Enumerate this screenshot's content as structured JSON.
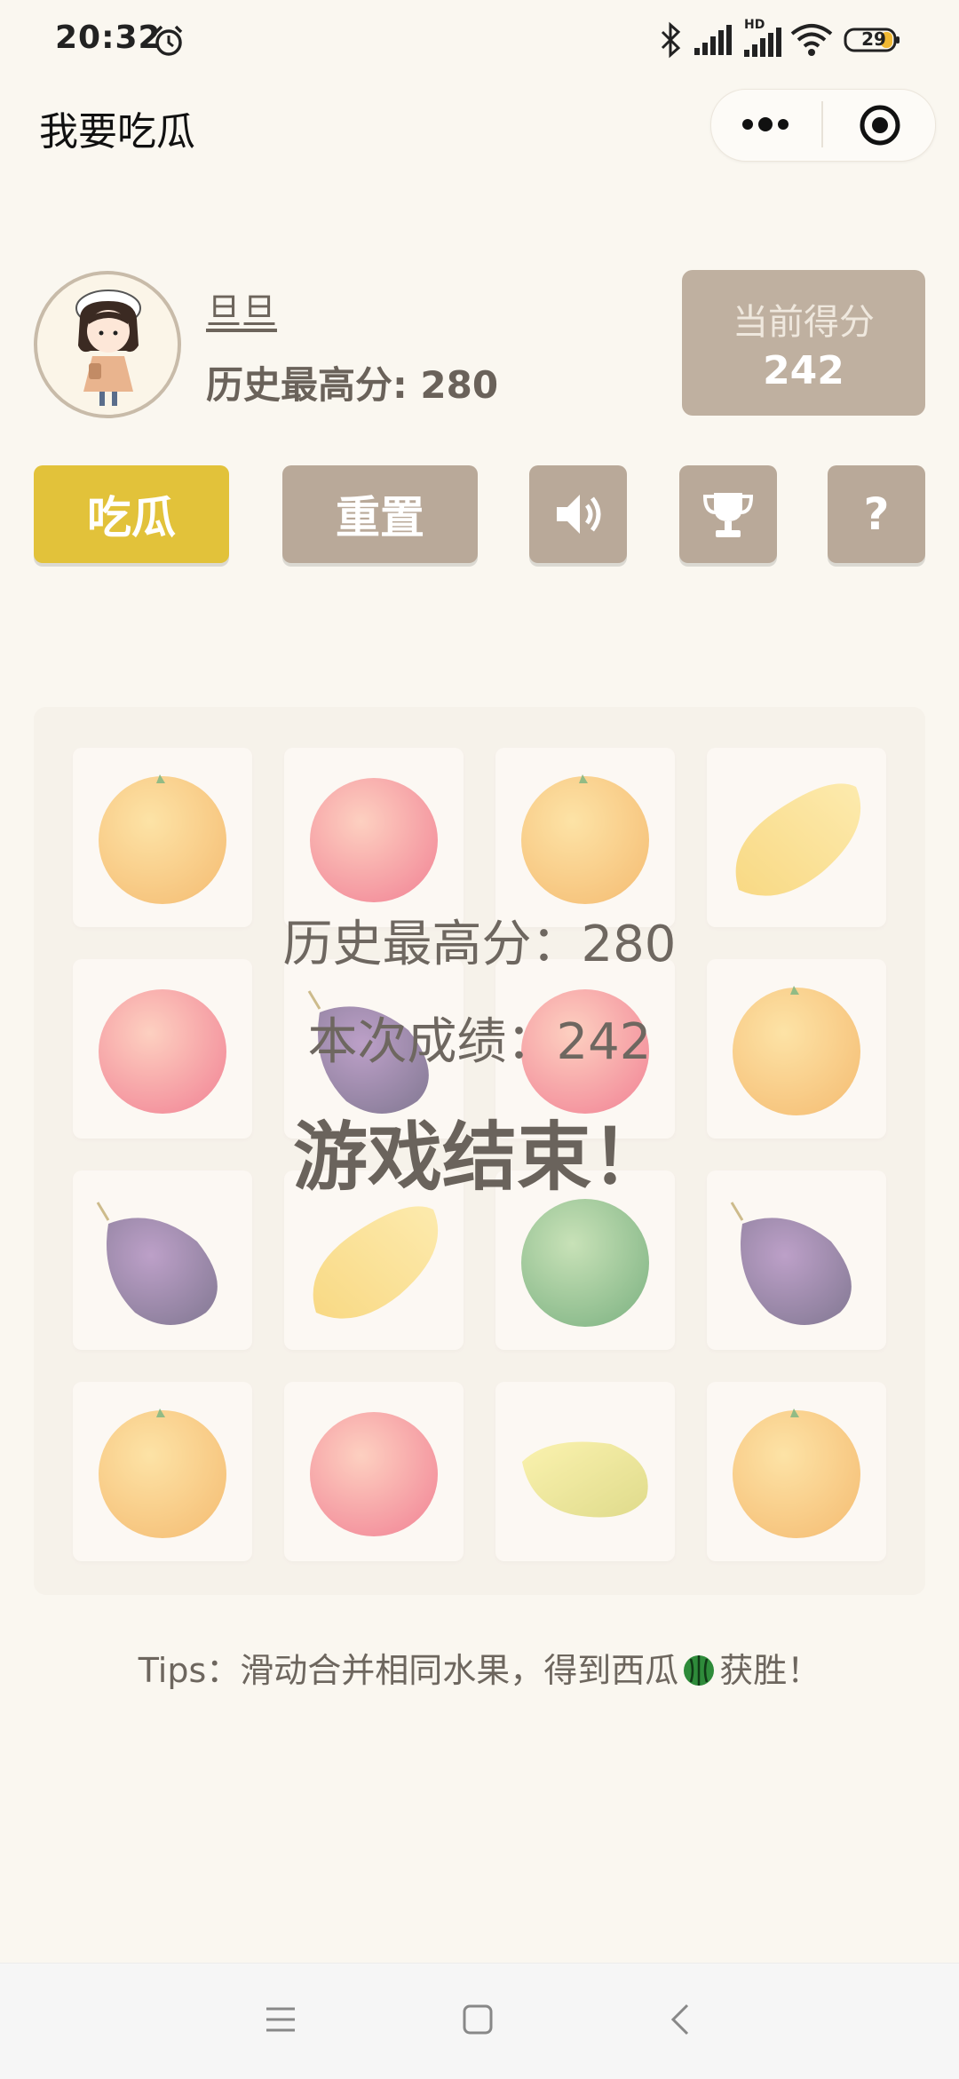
{
  "status_bar": {
    "time": "20:32",
    "battery": "29",
    "network_badge": "HD"
  },
  "header": {
    "title": "我要吃瓜"
  },
  "profile": {
    "username": "旦旦",
    "best_score": "历史最高分: 280"
  },
  "score_panel": {
    "label": "当前得分",
    "value": "242"
  },
  "buttons": {
    "eat": "吃瓜",
    "reset": "重置",
    "sound_icon": "speaker-icon",
    "rank_icon": "trophy-icon",
    "help": "?"
  },
  "board": {
    "rows": [
      [
        "orange",
        "peach",
        "orange",
        "mango"
      ],
      [
        "peach",
        "plum",
        "peach",
        "orange"
      ],
      [
        "plum",
        "mango",
        "lime",
        "plum"
      ],
      [
        "orange",
        "peach",
        "starfruit",
        "orange"
      ]
    ]
  },
  "game_over": {
    "best": "历史最高分：280",
    "score": "本次成绩：242",
    "title": "游戏结束！"
  },
  "tips": {
    "before": "Tips：滑动合并相同水果，得到西瓜",
    "after": "获胜！"
  },
  "colors": {
    "accent_yellow": "#e2c23a",
    "button_gray": "#b9a999",
    "background": "#faf7f0"
  }
}
